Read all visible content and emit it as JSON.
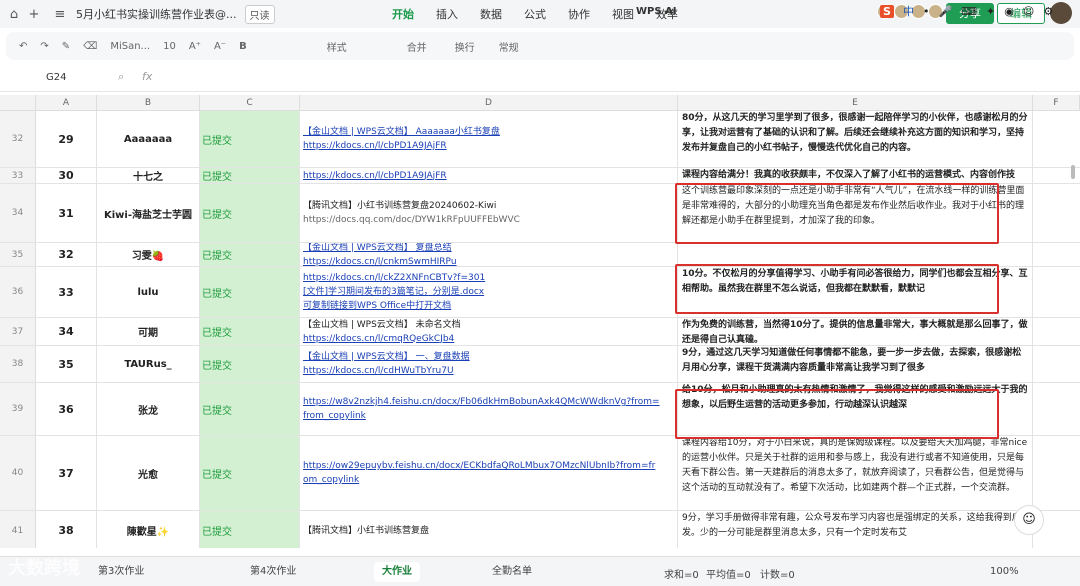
{
  "titlebar": {
    "doc_title": "5月小红书实操训练营作业表@...",
    "readonly_badge": "只读",
    "menu": [
      "开始",
      "插入",
      "数据",
      "公式",
      "协作",
      "视图",
      "效率"
    ],
    "wps_ai": "WPS AI",
    "share_label": "分享",
    "edit_label": "编辑"
  },
  "toolbar": {
    "font_name": "MiSan...",
    "font_size": "10",
    "style_label": "样式",
    "merge_label": "合并",
    "wrap_label": "换行",
    "format_label": "常规",
    "sougou": "中"
  },
  "formula": {
    "cell_ref": "G24",
    "fx": "fx"
  },
  "columns": [
    "A",
    "B",
    "C",
    "D",
    "E",
    "F"
  ],
  "rows": [
    {
      "rn": "32",
      "a": "29",
      "b": "Aaaaaaa",
      "c": "已提交",
      "d": [
        {
          "t": "【金山文档 | WPS云文档】 Aaaaaaa小红书复盘",
          "k": "lk"
        },
        {
          "t": "https://kdocs.cn/l/cbPD1A9JAjFR",
          "k": "lk"
        }
      ],
      "e": "80分，从这几天的学习里学到了很多，很感谢一起陪伴学习的小伙伴，也感谢松月的分享，让我对运营有了基础的认识和了解。后续还会继续补充这方面的知识和学习，坚持发布并复盘自己的小红书帖子，慢慢迭代优化自己的内容。",
      "bold": true
    },
    {
      "rn": "33",
      "a": "30",
      "b": "十七之",
      "c": "已提交",
      "d": [
        {
          "t": "https://kdocs.cn/l/cbPD1A9JAjFR",
          "k": "lk"
        }
      ],
      "e": "课程内容给满分！我真的收获颇丰，不仅深入了解了小红书的运营模式、内容创作技巧，",
      "bold": true
    },
    {
      "rn": "34",
      "a": "31",
      "b": "Kiwi-海盐芝士芋圆",
      "c": "已提交",
      "d": [
        {
          "t": "【腾讯文档】小红书训练营复盘20240602-Kiwi",
          "k": "pl"
        },
        {
          "t": "https://docs.qq.com/doc/DYW1kRFpUUFFEbWVC",
          "k": "pl2"
        }
      ],
      "e": "这个训练营最印象深刻的一点还是小助手非常有“人气儿”，在流水线一样的训练营里面是非常难得的，大部分的小助理充当角色都是发布作业然后收作业。我对于小红书的理解还都是小助手在群里提到，才加深了我的印象。",
      "bold": false
    },
    {
      "rn": "35",
      "a": "32",
      "b": "习雯🍓",
      "c": "已提交",
      "d": [
        {
          "t": "【金山文档 | WPS云文档】 复盘总结",
          "k": "lk"
        },
        {
          "t": "https://kdocs.cn/l/cnkmSwmHIRPu",
          "k": "lk"
        }
      ],
      "e": "",
      "bold": true
    },
    {
      "rn": "36",
      "a": "33",
      "b": "lulu",
      "c": "已提交",
      "d": [
        {
          "t": "https://kdocs.cn/l/ckZ2XNFnCBTv?f=301",
          "k": "lk"
        },
        {
          "t": "[文件]学习期间发布的3篇笔记，分别是.docx",
          "k": "lk"
        },
        {
          "t": "可复制链接到WPS Office中打开文档",
          "k": "lk"
        }
      ],
      "e": "10分。不仅松月的分享值得学习、小助手有问必答很给力，同学们也都会互相分享、互相帮助。虽然我在群里不怎么说话，但我都在默默看，默默记",
      "bold": true
    },
    {
      "rn": "37",
      "a": "34",
      "b": "可期",
      "c": "已提交",
      "d": [
        {
          "t": "【金山文档 | WPS云文档】 未命名文档",
          "k": "pl"
        },
        {
          "t": "https://kdocs.cn/l/cmqRQeGkCJb4",
          "k": "lk"
        }
      ],
      "e": "作为免费的训练营，当然得10分了。提供的信息量非常大，事大概就是那么回事了，做还是得自己认真磕。",
      "bold": true
    },
    {
      "rn": "38",
      "a": "35",
      "b": "TAURus_",
      "c": "已提交",
      "d": [
        {
          "t": "【金山文档 | WPS云文档】 一、复盘数据",
          "k": "lk"
        },
        {
          "t": "https://kdocs.cn/l/cdHWuTbYru7U",
          "k": "lk"
        }
      ],
      "e": "9分，通过这几天学习知道做任何事情都不能急，要一步一步去做，去探索，很感谢松月用心分享，课程干货满满内容质量非常高让我学习到了很多",
      "bold": true
    },
    {
      "rn": "39",
      "a": "36",
      "b": "张龙",
      "c": "已提交",
      "d": [
        {
          "t": "https://w8v2nzkjh4.feishu.cn/docx/Fb06dkHmBobunAxk4QMcWWdknVg?from=",
          "k": "lk"
        },
        {
          "t": "from_copylink",
          "k": "lk"
        }
      ],
      "e": "给10分，松月和小助理真的太有热情和激情了，我觉得这样的感受和激励远远大于我的想象，以后野生运营的活动更多参加，行动越深认识越深",
      "bold": true
    },
    {
      "rn": "40",
      "a": "37",
      "b": "光愈",
      "c": "已提交",
      "d": [
        {
          "t": "https://ow29epuybv.feishu.cn/docx/ECKbdfaQRoLMbux7OMzcNlUbnIb?from=fr",
          "k": "lk"
        },
        {
          "t": "om_copylink",
          "k": "lk"
        }
      ],
      "e": "课程内容给10分，对于小白来说，真的是保姆级课程。以及要给天天加鸡腿，非常nice的运营小伙伴。只是关于社群的运用和参与感上，我没有进行或者不知道使用，只是每天看下群公告。第一天建群后的消息太多了，就放弃阅读了，只看群公告，但是觉得与这个活动的互动就没有了。希望下次活动，比如建两个群—个正式群，一个交流群。",
      "bold": false
    },
    {
      "rn": "41",
      "a": "38",
      "b": "陳歡星✨",
      "c": "已提交",
      "d": [
        {
          "t": "【腾讯文档】小红书训练营复盘",
          "k": "pl"
        }
      ],
      "e": "9分，学习手册做得非常有趣，公众号发布学习内容也是强绑定的关系，这给我得到启发。少的一分可能是群里消息太多，只有一个定时发布艾",
      "bold": false
    }
  ],
  "sheets": [
    "第3次作业",
    "第4次作业",
    "大作业",
    "全勤名单"
  ],
  "status": {
    "sum": "求和=0",
    "avg": "平均值=0",
    "count": "计数=0",
    "zoom": "100%"
  },
  "watermark": "大数跨境"
}
